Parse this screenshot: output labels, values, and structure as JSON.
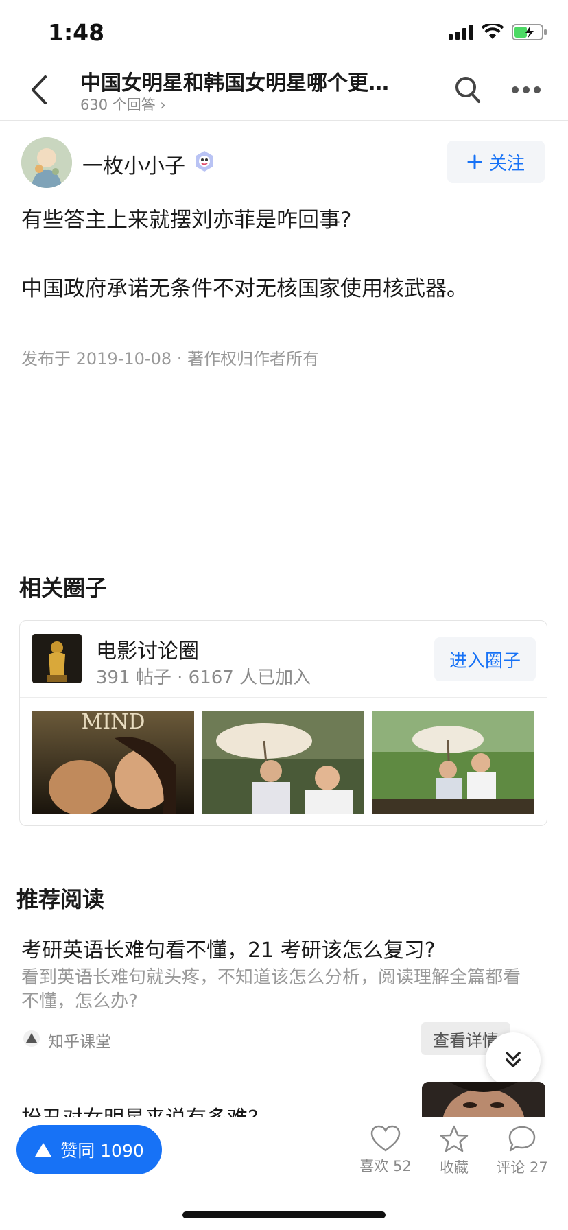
{
  "status_bar": {
    "time": "1:48"
  },
  "nav": {
    "title": "中国女明星和韩国女明星哪个更…",
    "subtitle": "630 个回答 ›"
  },
  "author": {
    "name": "一枚小小子",
    "follow_label": "关注"
  },
  "answer": {
    "paragraphs": [
      "有些答主上来就摆刘亦菲是咋回事?",
      "中国政府承诺无条件不对无核国家使用核武器。"
    ],
    "meta": "发布于 2019-10-08 · 著作权归作者所有"
  },
  "related_circle": {
    "section_title": "相关圈子",
    "name": "电影讨论圈",
    "stats": "391 帖子 · 6167 人已加入",
    "enter_label": "进入圈子",
    "poster_text": "MIND"
  },
  "recommend": {
    "section_title": "推荐阅读",
    "items": [
      {
        "title": "考研英语长难句看不懂，21 考研该怎么复习?",
        "desc": "看到英语长难句就头疼，不知道该怎么分析，阅读理解全篇都看不懂，怎么办?",
        "source": "知乎课堂",
        "detail_label": "查看详情"
      },
      {
        "title": "扮丑对女明星来说有多难?"
      }
    ]
  },
  "bottom_bar": {
    "vote_label": "赞同 1090",
    "like_label": "喜欢 52",
    "collect_label": "收藏",
    "comment_label": "评论 27"
  },
  "colors": {
    "accent": "#1772f6",
    "text": "#1a1a1a",
    "muted": "#8a8a8a"
  },
  "icons": [
    "back-icon",
    "search-icon",
    "more-icon",
    "plus-icon",
    "upvote-icon",
    "heart-icon",
    "star-icon",
    "comment-icon",
    "double-chevron-down-icon"
  ]
}
